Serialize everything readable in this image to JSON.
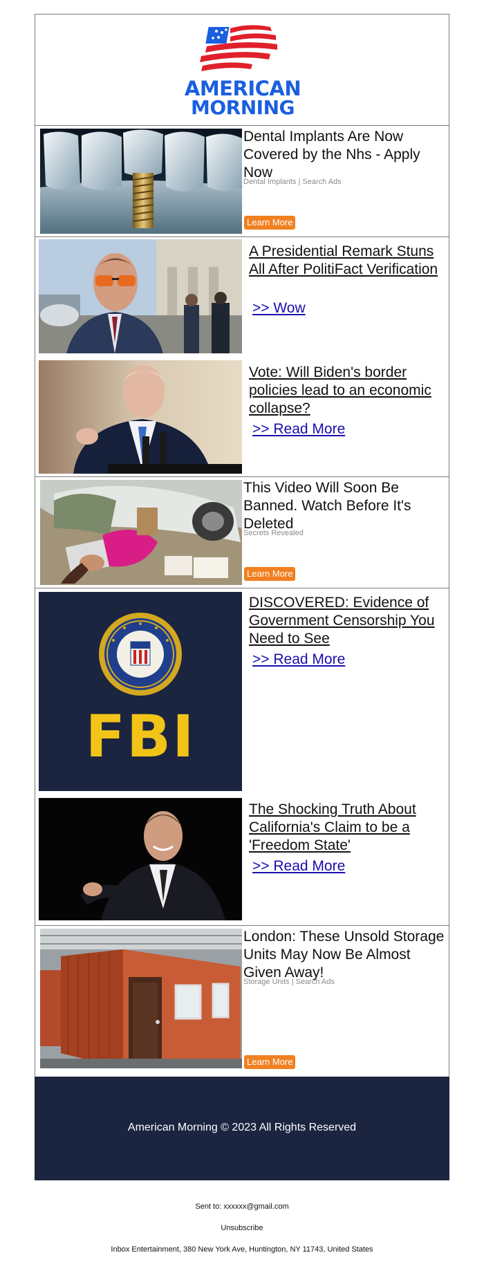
{
  "brand": {
    "name_line1": "AMERICAN",
    "name_line2": "MORNING",
    "colors": {
      "blue": "#1a5fe0",
      "red": "#e0202a",
      "navy": "#1b2540",
      "orange": "#f08020"
    }
  },
  "ads": [
    {
      "title": "Dental Implants Are Now Covered by the Nhs - Apply Now",
      "sponsor": "Dental Implants | Search Ads",
      "button": "Learn More",
      "image": "dental-implant-image"
    },
    {
      "title": "This Video Will Soon Be Banned. Watch Before It's Deleted",
      "sponsor": "Secrets Revealed",
      "button": "Learn More",
      "image": "car-accident-image"
    },
    {
      "title": "London: These Unsold Storage Units May Now Be Almost Given Away!",
      "sponsor": "Storage Units | Search Ads",
      "button": "Learn More",
      "image": "storage-container-image"
    }
  ],
  "articles": [
    {
      "title": "A Presidential Remark Stuns All After PolitiFact Verification",
      "link": ">> Wow",
      "image": "congressman-photo"
    },
    {
      "title": "Vote: Will Biden's border policies lead to an economic collapse?",
      "link": ">> Read More",
      "image": "biden-photo"
    },
    {
      "title": "DISCOVERED: Evidence of Government Censorship You Need to See",
      "link": ">> Read More",
      "image": "fbi-logo",
      "fbi_text": "FBI"
    },
    {
      "title": "The Shocking Truth About California's Claim to be a 'Freedom State'",
      "link": ">> Read More",
      "image": "newsom-photo"
    }
  ],
  "footer": {
    "copyright": "American Morning © 2023 All Rights Reserved",
    "sent_to": "Sent to: xxxxxx@gmail.com",
    "unsubscribe": "Unsubscribe",
    "address": "Inbox Entertainment, 380 New York Ave, Huntington, NY 11743, United States"
  }
}
